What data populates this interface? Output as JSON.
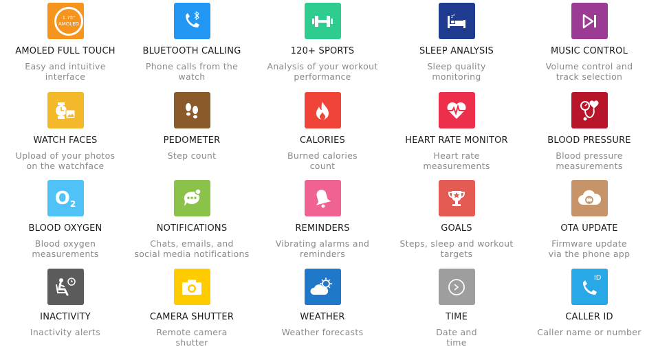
{
  "features": [
    {
      "title": "AMOLED FULL TOUCH",
      "desc": "Easy and intuitive\ninterface",
      "icon": "amoled-display-icon",
      "color": "#f7941d",
      "badge_size": "1.75\"",
      "badge_text": "AMOLED"
    },
    {
      "title": "BLUETOOTH CALLING",
      "desc": "Phone calls from the\nwatch",
      "icon": "bluetooth-phone-icon",
      "color": "#2196f3"
    },
    {
      "title": "120+ SPORTS",
      "desc": "Analysis of your workout\nperformance",
      "icon": "dumbbell-icon",
      "color": "#2ecc8f"
    },
    {
      "title": "SLEEP ANALYSIS",
      "desc": "Sleep quality\nmonitoring",
      "icon": "bed-icon",
      "color": "#1f3b8f"
    },
    {
      "title": "MUSIC CONTROL",
      "desc": "Volume control and\ntrack selection",
      "icon": "play-next-icon",
      "color": "#9c3b93"
    },
    {
      "title": "WATCH FACES",
      "desc": "Upload of your photos\non the watchface",
      "icon": "watch-photo-icon",
      "color": "#f3b92b"
    },
    {
      "title": "PEDOMETER",
      "desc": "Step count",
      "icon": "footprints-icon",
      "color": "#8b5a2b"
    },
    {
      "title": "CALORIES",
      "desc": "Burned calories\ncount",
      "icon": "flame-icon",
      "color": "#f04438"
    },
    {
      "title": "HEART RATE MONITOR",
      "desc": "Heart rate\nmeasurements",
      "icon": "heart-pulse-icon",
      "color": "#ec2f4b"
    },
    {
      "title": "BLOOD PRESSURE",
      "desc": "Blood pressure\nmeasurements",
      "icon": "blood-pressure-icon",
      "color": "#b8142a"
    },
    {
      "title": "BLOOD OXYGEN",
      "desc": "Blood oxygen\nmeasurements",
      "icon": "oxygen-icon",
      "color": "#4fc3f7",
      "badge_text": "O",
      "badge_sub": "2"
    },
    {
      "title": "NOTIFICATIONS",
      "desc": "Chats, emails, and\nsocial media notifications",
      "icon": "chat-bubble-icon",
      "color": "#8bc34a"
    },
    {
      "title": "REMINDERS",
      "desc": "Vibrating alarms and\nreminders",
      "icon": "bell-icon",
      "color": "#f06292"
    },
    {
      "title": "GOALS",
      "desc": "Steps, sleep and workout\ntargets",
      "icon": "trophy-icon",
      "color": "#e35b53"
    },
    {
      "title": "OTA UPDATE",
      "desc": "Firmware update\nvia the phone app",
      "icon": "cloud-sync-icon",
      "color": "#c7946a"
    },
    {
      "title": "INACTIVITY",
      "desc": "Inactivity alerts",
      "icon": "sitting-person-icon",
      "color": "#5b5b5b"
    },
    {
      "title": "CAMERA SHUTTER",
      "desc": "Remote camera\nshutter",
      "icon": "camera-icon",
      "color": "#ffcc00"
    },
    {
      "title": "WEATHER",
      "desc": "Weather forecasts",
      "icon": "weather-icon",
      "color": "#1f78c8"
    },
    {
      "title": "TIME",
      "desc": "Date and\ntime",
      "icon": "clock-icon",
      "color": "#9e9e9e"
    },
    {
      "title": "CALLER ID",
      "desc": "Caller name or number",
      "icon": "caller-id-icon",
      "color": "#29a8e8",
      "badge_text": "ID"
    }
  ]
}
